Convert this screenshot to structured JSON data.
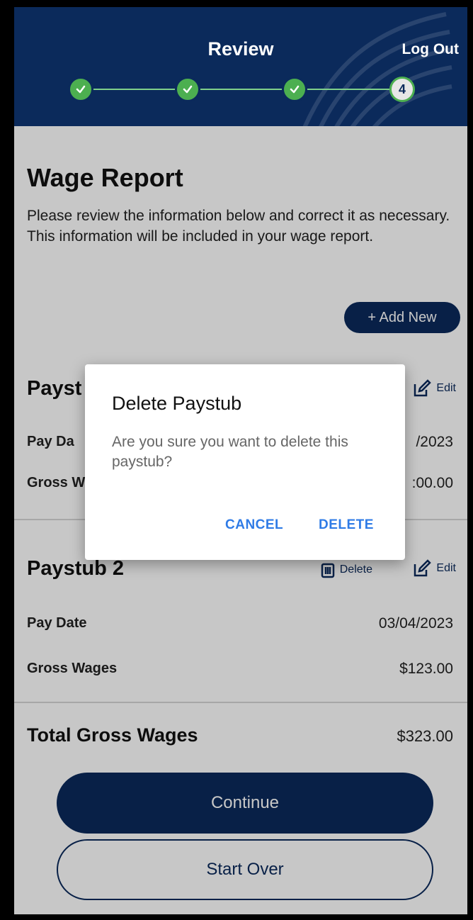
{
  "header": {
    "title": "Review",
    "logout_label": "Log Out",
    "steps": [
      {
        "state": "done"
      },
      {
        "state": "done"
      },
      {
        "state": "done"
      },
      {
        "state": "current",
        "label": "4"
      }
    ]
  },
  "main": {
    "title": "Wage Report",
    "intro": "Please review the information below and correct it as necessary. This information will be included in your wage report.",
    "add_new_label": "+ Add New",
    "paystub1": {
      "title_visible": "Payst",
      "edit_label": "Edit",
      "pay_date_label_visible": "Pay Da",
      "pay_date_value_visible": "/2023",
      "gross_label_visible": "Gross W",
      "gross_value_visible": ":00.00"
    },
    "paystub2": {
      "title_visible": "Paystub 2",
      "delete_label": "Delete",
      "edit_label": "Edit",
      "pay_date_label": "Pay Date",
      "pay_date_value": "03/04/2023",
      "gross_label": "Gross Wages",
      "gross_value": "$123.00"
    },
    "total_label": "Total Gross Wages",
    "total_value": "$323.00",
    "continue_label": "Continue",
    "start_over_label": "Start Over"
  },
  "dialog": {
    "title": "Delete Paystub",
    "message": "Are you sure you want to delete this paystub?",
    "cancel_label": "CANCEL",
    "delete_label": "DELETE"
  },
  "colors": {
    "brand_navy": "#0b2a5b",
    "step_green": "#4caf50",
    "dialog_action_blue": "#2f7be6"
  }
}
